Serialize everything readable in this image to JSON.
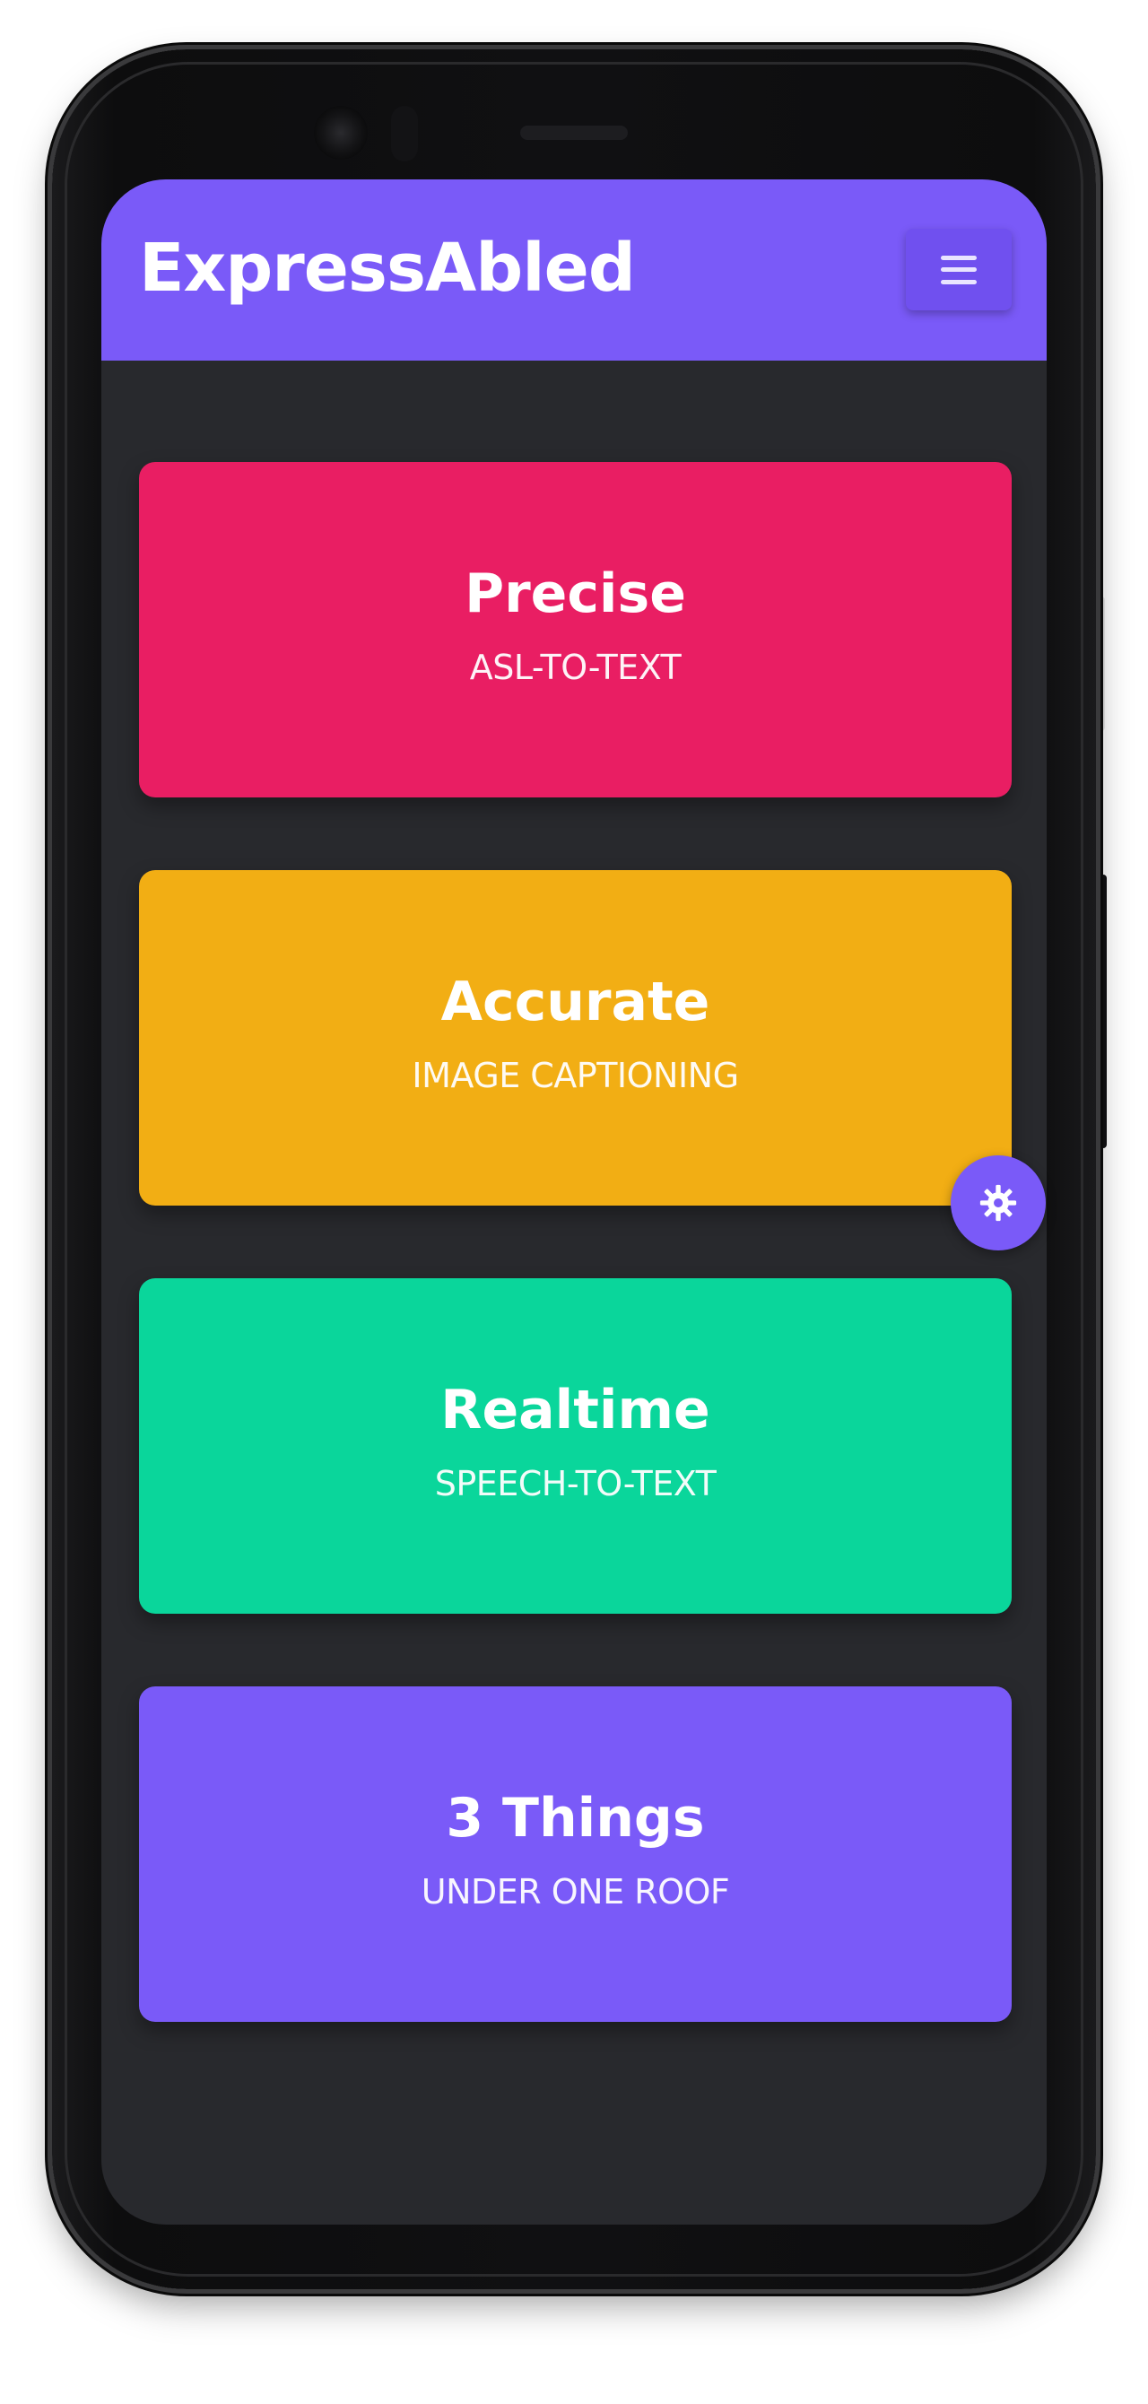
{
  "app": {
    "brand": "ExpressAbled",
    "menu_icon": "hamburger-menu-icon",
    "settings_icon": "gear-icon"
  },
  "colors": {
    "primary": "#7a5af8",
    "background": "#28292d",
    "precise": "#e91e63",
    "accurate": "#f2ae14",
    "realtime": "#0ad69b",
    "things": "#7a5af8"
  },
  "cards": [
    {
      "title": "Precise",
      "subtitle": "ASL-TO-TEXT"
    },
    {
      "title": "Accurate",
      "subtitle": "IMAGE CAPTIONING"
    },
    {
      "title": "Realtime",
      "subtitle": "SPEECH-TO-TEXT"
    },
    {
      "title": "3 Things",
      "subtitle": "UNDER ONE ROOF"
    }
  ]
}
